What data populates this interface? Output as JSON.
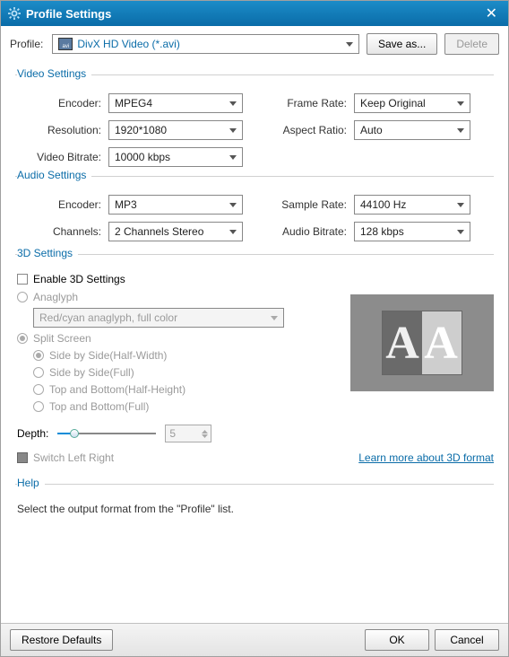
{
  "window": {
    "title": "Profile Settings"
  },
  "profile": {
    "label": "Profile:",
    "value": "DivX HD Video (*.avi)",
    "save_as": "Save as...",
    "delete": "Delete"
  },
  "video": {
    "group": "Video Settings",
    "encoder_label": "Encoder:",
    "encoder": "MPEG4",
    "resolution_label": "Resolution:",
    "resolution": "1920*1080",
    "bitrate_label": "Video Bitrate:",
    "bitrate": "10000 kbps",
    "framerate_label": "Frame Rate:",
    "framerate": "Keep Original",
    "aspect_label": "Aspect Ratio:",
    "aspect": "Auto"
  },
  "audio": {
    "group": "Audio Settings",
    "encoder_label": "Encoder:",
    "encoder": "MP3",
    "channels_label": "Channels:",
    "channels": "2 Channels Stereo",
    "samplerate_label": "Sample Rate:",
    "samplerate": "44100 Hz",
    "bitrate_label": "Audio Bitrate:",
    "bitrate": "128 kbps"
  },
  "d3": {
    "group": "3D Settings",
    "enable": "Enable 3D Settings",
    "anaglyph": "Anaglyph",
    "anaglyph_mode": "Red/cyan anaglyph, full color",
    "split": "Split Screen",
    "sbs_half": "Side by Side(Half-Width)",
    "sbs_full": "Side by Side(Full)",
    "tb_half": "Top and Bottom(Half-Height)",
    "tb_full": "Top and Bottom(Full)",
    "depth_label": "Depth:",
    "depth_value": "5",
    "switch": "Switch Left Right",
    "learn": "Learn more about 3D format"
  },
  "help": {
    "group": "Help",
    "text": "Select the output format from the \"Profile\" list."
  },
  "footer": {
    "restore": "Restore Defaults",
    "ok": "OK",
    "cancel": "Cancel"
  }
}
